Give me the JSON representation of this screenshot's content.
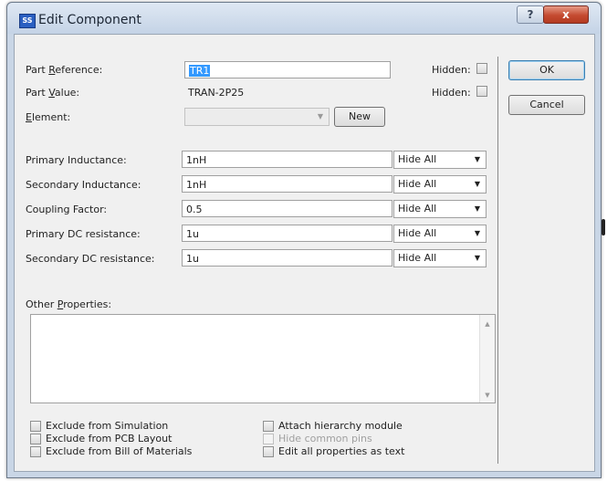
{
  "window": {
    "title": "Edit Component",
    "icon": "SS"
  },
  "titlebar": {
    "help_glyph": "?",
    "close_glyph": "x"
  },
  "fields": {
    "part_reference": {
      "label_pre": "Part ",
      "label_ul": "R",
      "label_post": "eference:",
      "value": "TR1"
    },
    "part_value": {
      "label_pre": "Part ",
      "label_ul": "V",
      "label_post": "alue:",
      "value": "TRAN-2P25"
    },
    "element": {
      "label_pre": "",
      "label_ul": "E",
      "label_post": "lement:",
      "value": ""
    },
    "hidden_label": "Hidden:",
    "new_button": "New"
  },
  "properties": [
    {
      "label": "Primary Inductance:",
      "value": "1nH",
      "visibility": "Hide All"
    },
    {
      "label": "Secondary Inductance:",
      "value": "1nH",
      "visibility": "Hide All"
    },
    {
      "label": "Coupling Factor:",
      "value": "0.5",
      "visibility": "Hide All"
    },
    {
      "label": "Primary DC resistance:",
      "value": "1u",
      "visibility": "Hide All"
    },
    {
      "label": "Secondary DC resistance:",
      "value": "1u",
      "visibility": "Hide All"
    }
  ],
  "other_properties": {
    "label_pre": "Other ",
    "label_ul": "P",
    "label_post": "roperties:",
    "value": ""
  },
  "options": {
    "exclude_simulation": "Exclude from Simulation",
    "exclude_pcb": "Exclude from PCB Layout",
    "exclude_bom": "Exclude from Bill of Materials",
    "attach_hierarchy": "Attach hierarchy module",
    "hide_common_pins": "Hide common pins",
    "edit_as_text": "Edit all properties as text"
  },
  "buttons": {
    "ok": "OK",
    "cancel": "Cancel"
  },
  "icons": {
    "dropdown": "chevron-down-icon",
    "scroll_up": "scroll-up-icon",
    "scroll_down": "scroll-down-icon"
  }
}
